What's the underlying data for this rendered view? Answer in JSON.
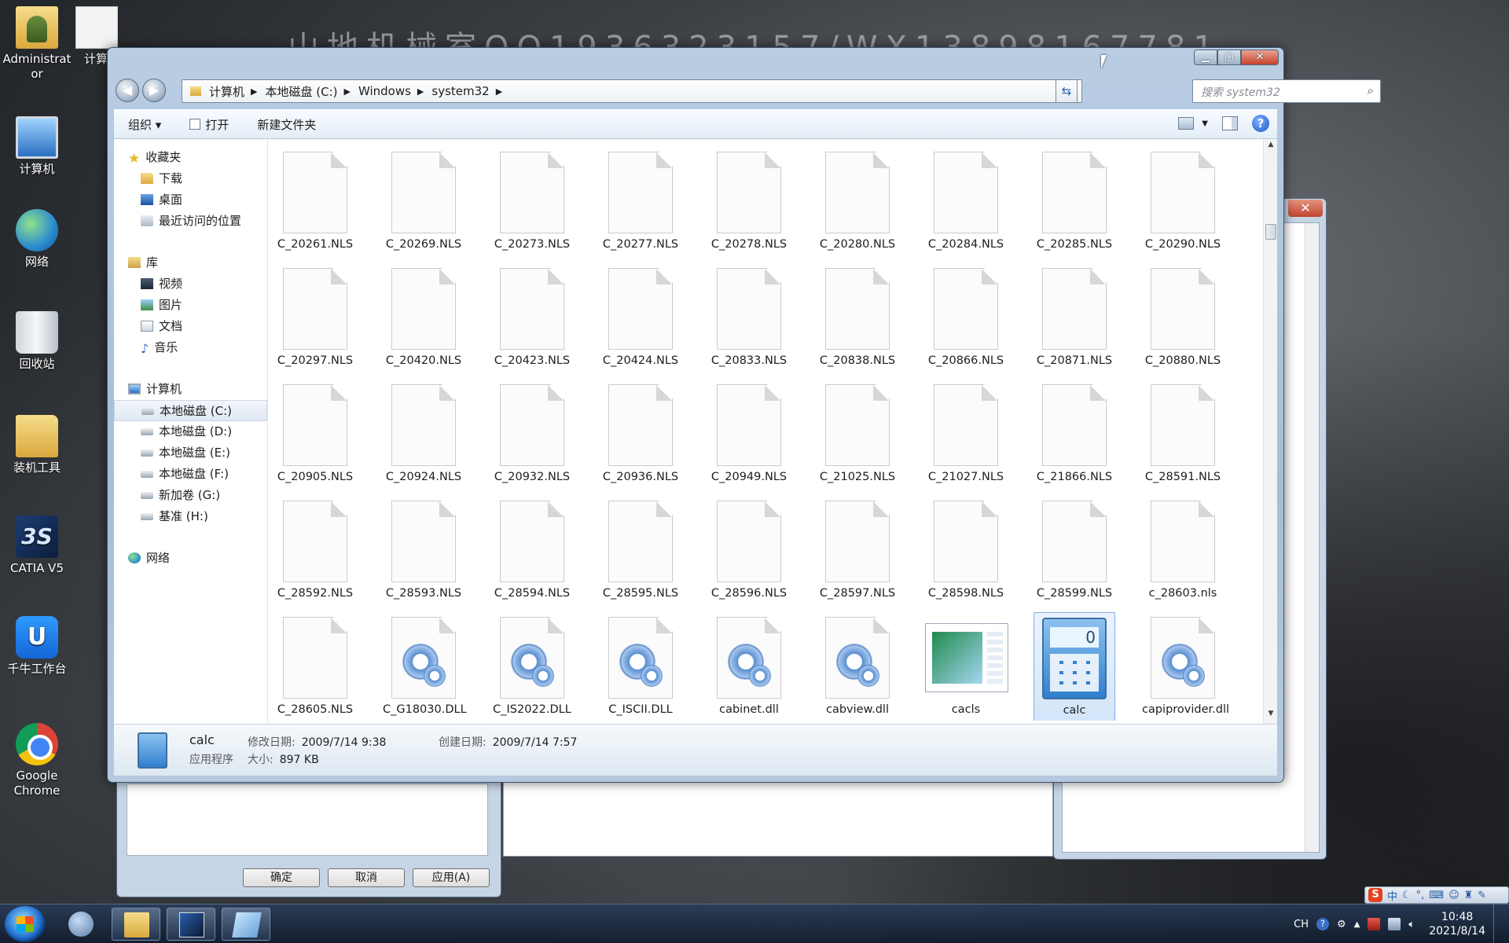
{
  "watermark": "山地机械室QQ1936323157/WX13898167781",
  "desktop": {
    "icons": [
      {
        "label": "Administrator",
        "icon": "user-folder-icon"
      },
      {
        "label": "计算",
        "icon": "document-icon"
      },
      {
        "label": "计算机",
        "icon": "computer-icon"
      },
      {
        "label": "网络",
        "icon": "network-icon"
      },
      {
        "label": "回收站",
        "icon": "recycle-bin-icon"
      },
      {
        "label": "装机工具",
        "icon": "folder-icon"
      },
      {
        "label": "CATIA V5",
        "icon": "catia-icon"
      },
      {
        "label": "千牛工作台",
        "icon": "qianniu-icon"
      },
      {
        "label": "Google Chrome",
        "icon": "chrome-icon"
      }
    ]
  },
  "explorer": {
    "address": {
      "crumbs": [
        "计算机",
        "本地磁盘 (C:)",
        "Windows",
        "system32"
      ]
    },
    "search": {
      "placeholder": "搜索 system32"
    },
    "toolbar": {
      "organize": "组织 ▾",
      "open": "打开",
      "new_folder": "新建文件夹"
    },
    "nav": {
      "favorites": "收藏夹",
      "downloads": "下载",
      "desktop": "桌面",
      "recent": "最近访问的位置",
      "libraries": "库",
      "videos": "视频",
      "pictures": "图片",
      "documents": "文档",
      "music": "音乐",
      "computer": "计算机",
      "drive_c": "本地磁盘 (C:)",
      "drive_d": "本地磁盘 (D:)",
      "drive_e": "本地磁盘 (E:)",
      "drive_f": "本地磁盘 (F:)",
      "drive_g": "新加卷 (G:)",
      "drive_h": "基准 (H:)",
      "network": "网络"
    },
    "files": [
      {
        "name": "C_20261.NLS",
        "kind": "file"
      },
      {
        "name": "C_20269.NLS",
        "kind": "file"
      },
      {
        "name": "C_20273.NLS",
        "kind": "file"
      },
      {
        "name": "C_20277.NLS",
        "kind": "file"
      },
      {
        "name": "C_20278.NLS",
        "kind": "file"
      },
      {
        "name": "C_20280.NLS",
        "kind": "file"
      },
      {
        "name": "C_20284.NLS",
        "kind": "file"
      },
      {
        "name": "C_20285.NLS",
        "kind": "file"
      },
      {
        "name": "C_20290.NLS",
        "kind": "file"
      },
      {
        "name": "C_20297.NLS",
        "kind": "file"
      },
      {
        "name": "C_20420.NLS",
        "kind": "file"
      },
      {
        "name": "C_20423.NLS",
        "kind": "file"
      },
      {
        "name": "C_20424.NLS",
        "kind": "file"
      },
      {
        "name": "C_20833.NLS",
        "kind": "file"
      },
      {
        "name": "C_20838.NLS",
        "kind": "file"
      },
      {
        "name": "C_20866.NLS",
        "kind": "file"
      },
      {
        "name": "C_20871.NLS",
        "kind": "file"
      },
      {
        "name": "C_20880.NLS",
        "kind": "file"
      },
      {
        "name": "C_20905.NLS",
        "kind": "file"
      },
      {
        "name": "C_20924.NLS",
        "kind": "file"
      },
      {
        "name": "C_20932.NLS",
        "kind": "file"
      },
      {
        "name": "C_20936.NLS",
        "kind": "file"
      },
      {
        "name": "C_20949.NLS",
        "kind": "file"
      },
      {
        "name": "C_21025.NLS",
        "kind": "file"
      },
      {
        "name": "C_21027.NLS",
        "kind": "file"
      },
      {
        "name": "C_21866.NLS",
        "kind": "file"
      },
      {
        "name": "C_28591.NLS",
        "kind": "file"
      },
      {
        "name": "C_28592.NLS",
        "kind": "file"
      },
      {
        "name": "C_28593.NLS",
        "kind": "file"
      },
      {
        "name": "C_28594.NLS",
        "kind": "file"
      },
      {
        "name": "C_28595.NLS",
        "kind": "file"
      },
      {
        "name": "C_28596.NLS",
        "kind": "file"
      },
      {
        "name": "C_28597.NLS",
        "kind": "file"
      },
      {
        "name": "C_28598.NLS",
        "kind": "file"
      },
      {
        "name": "C_28599.NLS",
        "kind": "file"
      },
      {
        "name": "c_28603.nls",
        "kind": "file"
      },
      {
        "name": "C_28605.NLS",
        "kind": "file"
      },
      {
        "name": "C_G18030.DLL",
        "kind": "dll"
      },
      {
        "name": "C_IS2022.DLL",
        "kind": "dll"
      },
      {
        "name": "C_ISCII.DLL",
        "kind": "dll"
      },
      {
        "name": "cabinet.dll",
        "kind": "dll"
      },
      {
        "name": "cabview.dll",
        "kind": "dll"
      },
      {
        "name": "cacls",
        "kind": "app-cacls"
      },
      {
        "name": "calc",
        "kind": "app-calc",
        "selected": true
      },
      {
        "name": "capiprovider.dll",
        "kind": "dll"
      }
    ],
    "details": {
      "name": "calc",
      "type": "应用程序",
      "modified_label": "修改日期:",
      "modified": "2009/7/14 9:38",
      "size_label": "大小:",
      "size": "897 KB",
      "created_label": "创建日期:",
      "created": "2009/7/14 7:57"
    }
  },
  "dialog": {
    "ok": "确定",
    "cancel": "取消",
    "apply": "应用(A)"
  },
  "taskbar": {
    "lang": "CH",
    "ime": "中",
    "time": "10:48",
    "date": "2021/8/14"
  }
}
